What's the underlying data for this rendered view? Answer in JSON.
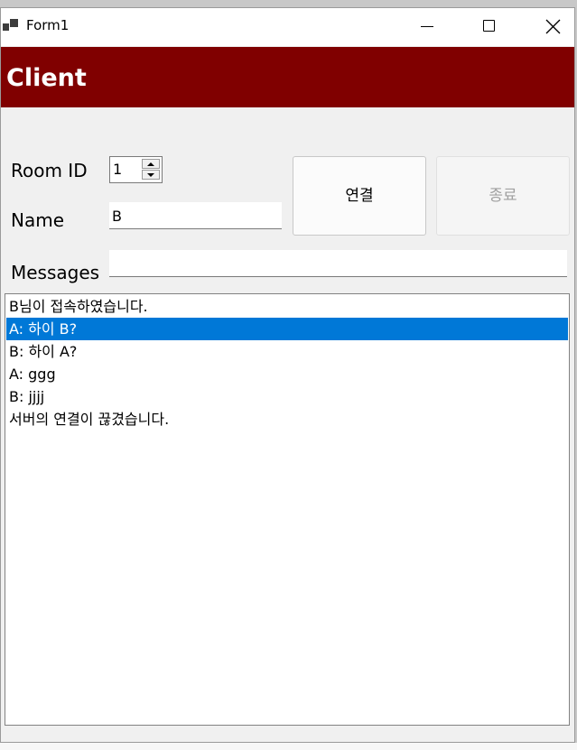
{
  "window": {
    "title": "Form1",
    "icons": {
      "app": "app-icon",
      "minimize": "minimize-icon",
      "maximize": "maximize-icon",
      "close": "close-icon"
    }
  },
  "banner": {
    "text": "Client",
    "color": "#800000"
  },
  "form": {
    "room_id_label": "Room ID",
    "room_id_value": "1",
    "name_label": "Name",
    "name_value": "B",
    "messages_label": "Messages",
    "messages_value": ""
  },
  "buttons": {
    "connect": "연결",
    "end": "종료"
  },
  "messages": [
    {
      "text": "B님이 접속하였습니다.",
      "selected": false
    },
    {
      "text": "A: 하이 B?",
      "selected": true
    },
    {
      "text": "B: 하이 A?",
      "selected": false
    },
    {
      "text": "A: ggg",
      "selected": false
    },
    {
      "text": "B: jjjj",
      "selected": false
    },
    {
      "text": "서버의 연결이 끊겼습니다.",
      "selected": false
    }
  ],
  "colors": {
    "selection": "#0078d7",
    "banner": "#800000"
  }
}
